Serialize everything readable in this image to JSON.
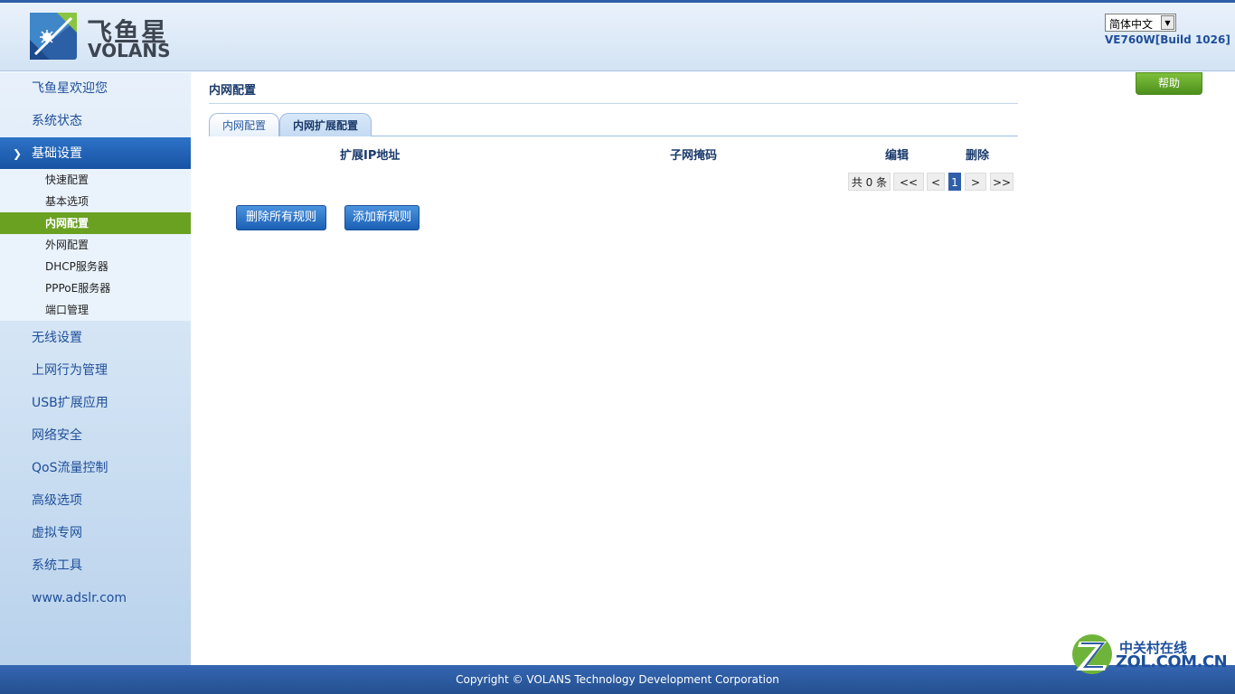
{
  "header": {
    "logo_cn": "飞鱼星",
    "logo_en": "VOLANS",
    "language_selected": "简体中文",
    "version": "VE760W[Build 1026]"
  },
  "sidebar": {
    "items": [
      {
        "label": "飞鱼星欢迎您"
      },
      {
        "label": "系统状态"
      },
      {
        "label": "基础设置",
        "expanded": true
      },
      {
        "label": "无线设置"
      },
      {
        "label": "上网行为管理"
      },
      {
        "label": "USB扩展应用"
      },
      {
        "label": "网络安全"
      },
      {
        "label": "QoS流量控制"
      },
      {
        "label": "高级选项"
      },
      {
        "label": "虚拟专网"
      },
      {
        "label": "系统工具"
      },
      {
        "label": "www.adslr.com"
      }
    ],
    "submenu": [
      {
        "label": "快速配置"
      },
      {
        "label": "基本选项"
      },
      {
        "label": "内网配置",
        "active": true
      },
      {
        "label": "外网配置"
      },
      {
        "label": "DHCP服务器"
      },
      {
        "label": "PPPoE服务器"
      },
      {
        "label": "端口管理"
      }
    ]
  },
  "main": {
    "page_title": "内网配置",
    "help_label": "帮助",
    "tabs": [
      {
        "label": "内网配置"
      },
      {
        "label": "内网扩展配置",
        "active": true
      }
    ],
    "table": {
      "columns": [
        "扩展IP地址",
        "子网掩码",
        "编辑",
        "删除"
      ],
      "rows": []
    },
    "pagination": {
      "total_text": "共 0 条",
      "first": "<<",
      "prev": "<",
      "current_page": "1",
      "next": ">",
      "last": ">>"
    },
    "buttons": {
      "delete_all": "删除所有规则",
      "add_new": "添加新规则"
    }
  },
  "footer": {
    "copyright": "Copyright © VOLANS Technology Development Corporation"
  },
  "watermark": {
    "cn": "中关村在线",
    "en": "ZOL.COM.CN"
  },
  "colors": {
    "accent_blue": "#2f5fa8",
    "active_green": "#6aa121",
    "help_green": "#5ea42a"
  }
}
